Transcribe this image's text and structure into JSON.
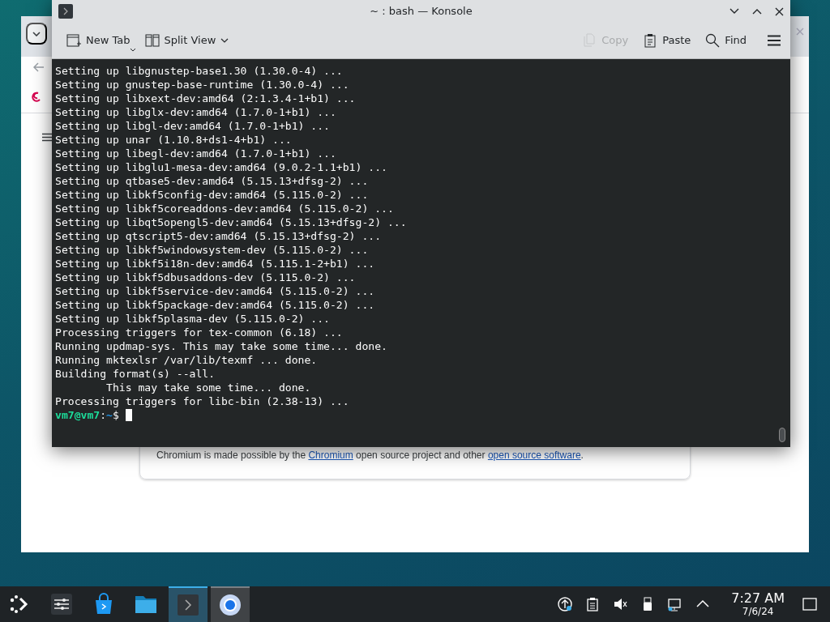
{
  "browser_window": {
    "credits": [
      {
        "kind": "text",
        "text": "Chromium is made possible by the "
      },
      {
        "kind": "link",
        "text": "Chromium"
      },
      {
        "kind": "text",
        "text": " open source project and other "
      },
      {
        "kind": "link",
        "text": "open source software"
      },
      {
        "kind": "text",
        "text": "."
      }
    ]
  },
  "konsole": {
    "title": "~ : bash — Konsole",
    "toolbar": [
      {
        "kind": "new-tab",
        "label": "New Tab",
        "disabled": false
      },
      {
        "kind": "split-view",
        "label": "Split View",
        "disabled": false
      },
      {
        "kind": "copy",
        "label": "Copy",
        "disabled": true
      },
      {
        "kind": "paste",
        "label": "Paste",
        "disabled": false
      },
      {
        "kind": "find",
        "label": "Find",
        "disabled": false
      }
    ],
    "lines": [
      "Setting up libgnustep-base1.30 (1.30.0-4) ...",
      "Setting up gnustep-base-runtime (1.30.0-4) ...",
      "Setting up libxext-dev:amd64 (2:1.3.4-1+b1) ...",
      "Setting up libglx-dev:amd64 (1.7.0-1+b1) ...",
      "Setting up libgl-dev:amd64 (1.7.0-1+b1) ...",
      "Setting up unar (1.10.8+ds1-4+b1) ...",
      "Setting up libegl-dev:amd64 (1.7.0-1+b1) ...",
      "Setting up libglu1-mesa-dev:amd64 (9.0.2-1.1+b1) ...",
      "Setting up qtbase5-dev:amd64 (5.15.13+dfsg-2) ...",
      "Setting up libkf5config-dev:amd64 (5.115.0-2) ...",
      "Setting up libkf5coreaddons-dev:amd64 (5.115.0-2) ...",
      "Setting up libqt5opengl5-dev:amd64 (5.15.13+dfsg-2) ...",
      "Setting up qtscript5-dev:amd64 (5.15.13+dfsg-2) ...",
      "Setting up libkf5windowsystem-dev (5.115.0-2) ...",
      "Setting up libkf5i18n-dev:amd64 (5.115.1-2+b1) ...",
      "Setting up libkf5dbusaddons-dev (5.115.0-2) ...",
      "Setting up libkf5service-dev:amd64 (5.115.0-2) ...",
      "Setting up libkf5package-dev:amd64 (5.115.0-2) ...",
      "Setting up libkf5plasma-dev (5.115.0-2) ...",
      "Processing triggers for tex-common (6.18) ...",
      "Running updmap-sys. This may take some time... done.",
      "Running mktexlsr /var/lib/texmf ... done.",
      "Building format(s) --all.",
      "        This may take some time... done.",
      "Processing triggers for libc-bin (2.38-13) ..."
    ],
    "prompt": {
      "user": "vm7@vm7",
      "separator": ":",
      "path": "~",
      "symbol": "$"
    }
  },
  "taskbar": {
    "tasks": [
      {
        "kind": "settings",
        "open": false,
        "active": false
      },
      {
        "kind": "store",
        "open": false,
        "active": false
      },
      {
        "kind": "files",
        "open": false,
        "active": false
      },
      {
        "kind": "terminal",
        "open": true,
        "active": true
      },
      {
        "kind": "browser",
        "open": true,
        "active": false
      }
    ],
    "tray": [
      {
        "kind": "update"
      },
      {
        "kind": "clipboard"
      },
      {
        "kind": "muted-volume"
      },
      {
        "kind": "usb"
      },
      {
        "kind": "network"
      },
      {
        "kind": "expand"
      }
    ],
    "clock": {
      "time": "7:27 AM",
      "date": "7/6/24"
    }
  }
}
